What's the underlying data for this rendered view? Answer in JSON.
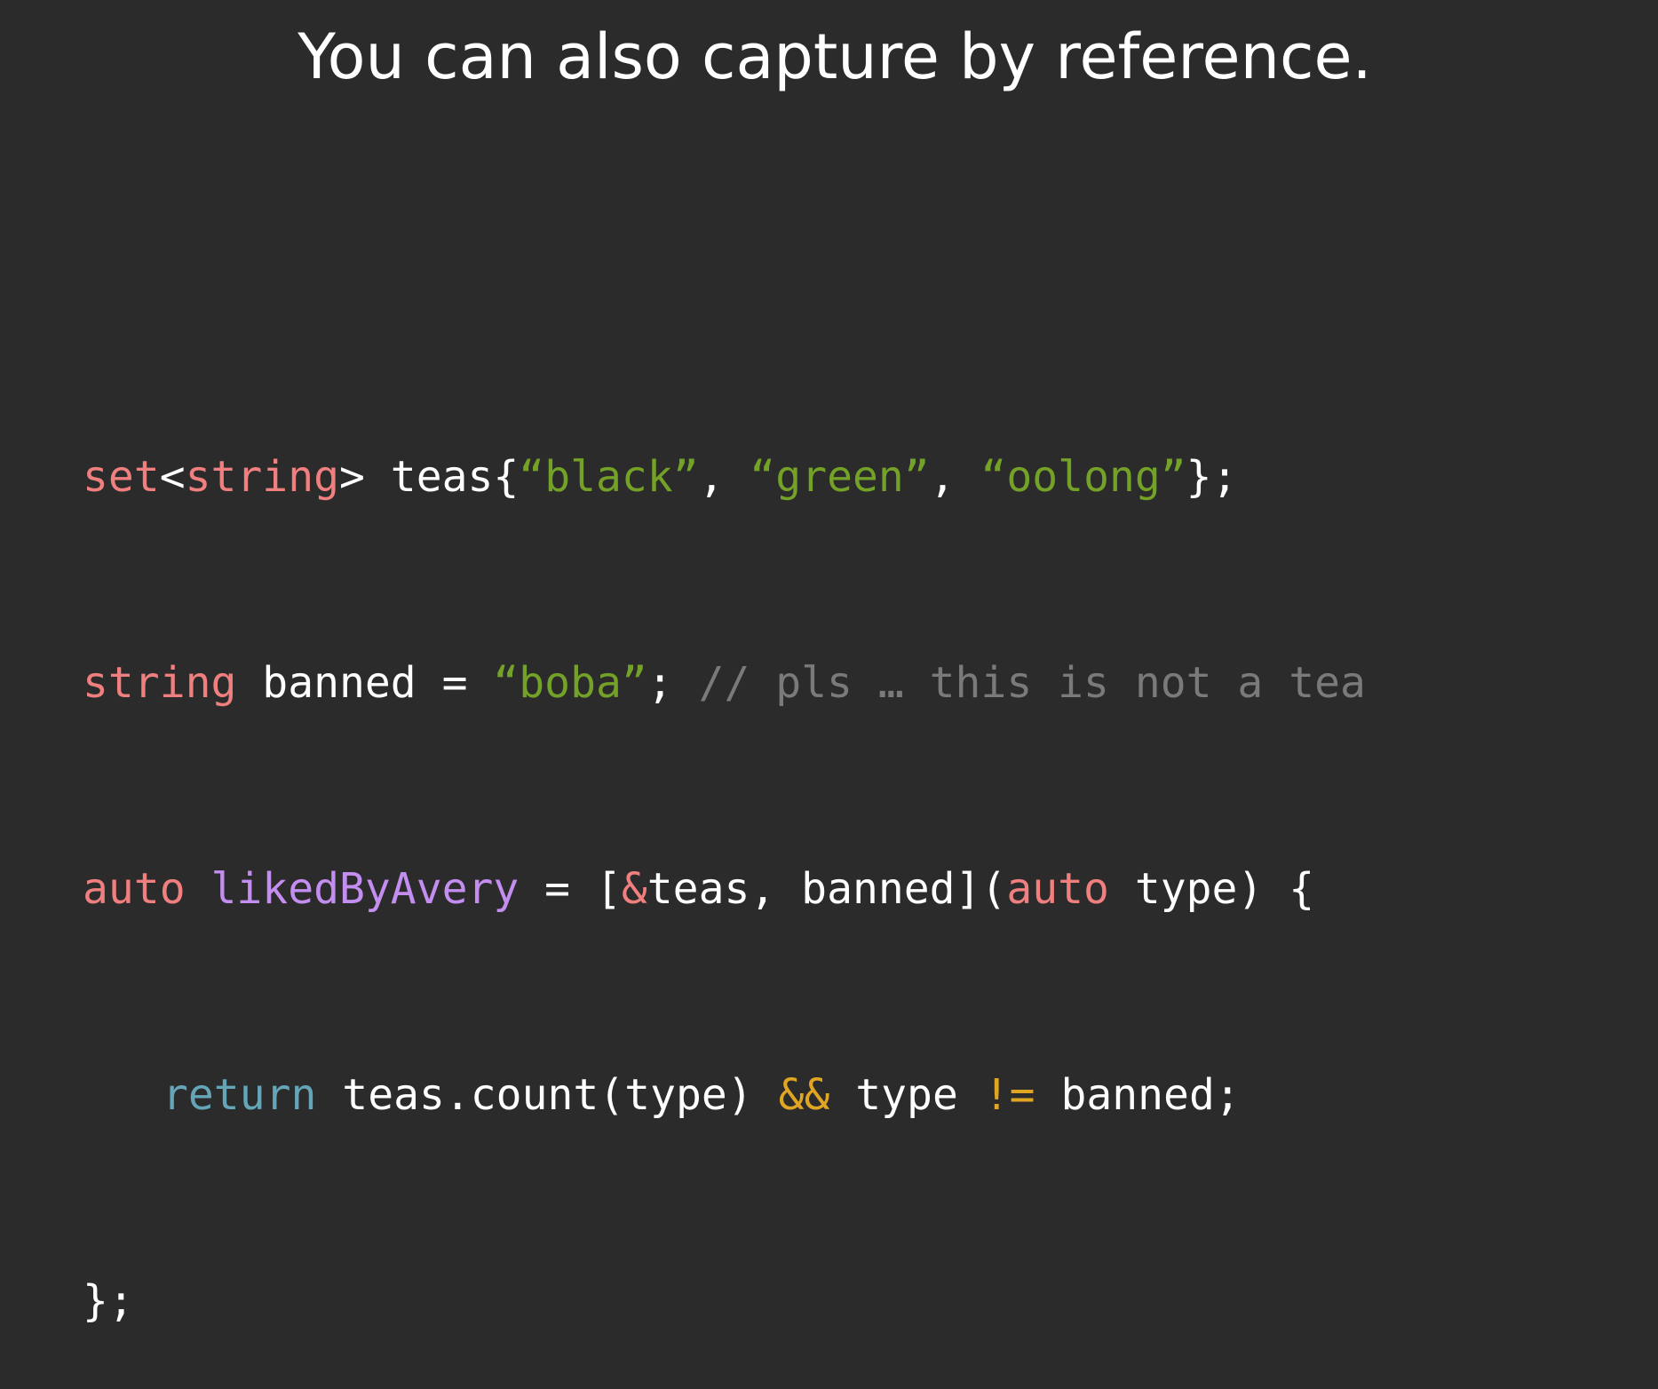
{
  "slide": {
    "title": "You can also capture by reference."
  },
  "code": {
    "lines": [
      [
        {
          "t": "set",
          "k": "kw"
        },
        {
          "t": "<",
          "k": "plain"
        },
        {
          "t": "string",
          "k": "kw"
        },
        {
          "t": "> teas{",
          "k": "plain"
        },
        {
          "t": "“black”",
          "k": "str"
        },
        {
          "t": ", ",
          "k": "plain"
        },
        {
          "t": "“green”",
          "k": "str"
        },
        {
          "t": ", ",
          "k": "plain"
        },
        {
          "t": "“oolong”",
          "k": "str"
        },
        {
          "t": "};",
          "k": "plain"
        }
      ],
      [
        {
          "t": "string",
          "k": "kw"
        },
        {
          "t": " banned = ",
          "k": "plain"
        },
        {
          "t": "“boba”",
          "k": "str"
        },
        {
          "t": "; ",
          "k": "plain"
        },
        {
          "t": "// pls … this is not a tea",
          "k": "cmt"
        }
      ],
      [
        {
          "t": "auto",
          "k": "kw"
        },
        {
          "t": " ",
          "k": "plain"
        },
        {
          "t": "likedByAvery",
          "k": "fn"
        },
        {
          "t": " = [",
          "k": "plain"
        },
        {
          "t": "&",
          "k": "kw"
        },
        {
          "t": "teas, banned](",
          "k": "plain"
        },
        {
          "t": "auto",
          "k": "kw"
        },
        {
          "t": " type) {",
          "k": "plain"
        }
      ],
      [
        {
          "t": "return",
          "k": "ret"
        },
        {
          "t": " teas.count(type) ",
          "k": "plain"
        },
        {
          "t": "&&",
          "k": "op"
        },
        {
          "t": " type ",
          "k": "plain"
        },
        {
          "t": "!=",
          "k": "op"
        },
        {
          "t": " banned;",
          "k": "plain"
        }
      ],
      [
        {
          "t": "};",
          "k": "plain"
        }
      ]
    ]
  },
  "colors": {
    "background": "#2b2b2b",
    "keyword": "#f07f7f",
    "string": "#74a128",
    "comment": "#7a7a7a",
    "function": "#c38ef0",
    "return": "#64a5b8",
    "operator": "#e0a523",
    "text": "#ffffff"
  }
}
